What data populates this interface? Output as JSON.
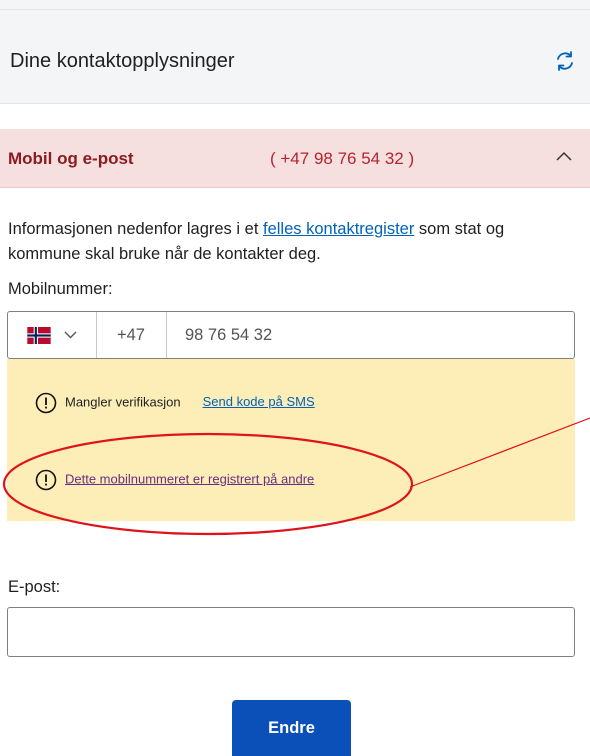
{
  "header": {
    "title": "Dine kontaktopplysninger",
    "refresh_icon": "refresh-icon"
  },
  "section": {
    "label": "Mobil og e-post",
    "phone_summary": "( +47 98 76 54 32 )",
    "toggle_icon": "chevron-up-icon"
  },
  "info": {
    "text_before": "Informasjonen nedenfor lagres i et ",
    "link": "felles kontaktregister",
    "text_after": " som stat og kommune skal bruke når de kontakter deg."
  },
  "mobile": {
    "label": "Mobilnummer:",
    "country_flag": "norway-flag-icon",
    "prefix": "+47",
    "value": "98 76 54 32"
  },
  "warnings": {
    "verification_text": "Mangler verifikasjon",
    "verification_link": "Send kode på SMS",
    "registered_link": "Dette mobilnummeret er registrert på andre"
  },
  "email": {
    "label": "E-post:",
    "value": ""
  },
  "submit": {
    "label": "Endre"
  },
  "colors": {
    "section_bg": "#f6dfdf",
    "section_text": "#8a1c22",
    "warning_bg": "#fdeeb8",
    "link": "#0062ba",
    "button": "#0b4fb9",
    "annotation": "#e0131b"
  }
}
